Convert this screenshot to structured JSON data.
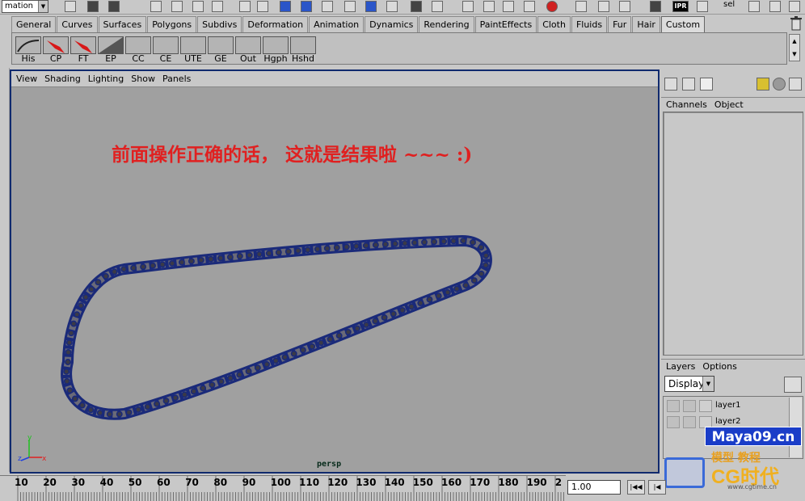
{
  "statusline": {
    "mode": "mation",
    "sel_label": "sel",
    "ipr_label": "IPR"
  },
  "shelf_tabs": [
    "General",
    "Curves",
    "Surfaces",
    "Polygons",
    "Subdivs",
    "Deformation",
    "Animation",
    "Dynamics",
    "Rendering",
    "PaintEffects",
    "Cloth",
    "Fluids",
    "Fur",
    "Hair",
    "Custom"
  ],
  "active_shelf_tab": "Custom",
  "shelf_buttons": [
    "His",
    "CP",
    "FT",
    "EP",
    "CC",
    "CE",
    "UTE",
    "GE",
    "Out",
    "Hgph",
    "Hshd"
  ],
  "panel_menu": [
    "View",
    "Shading",
    "Lighting",
    "Show",
    "Panels"
  ],
  "viewport": {
    "annotation": "前面操作正确的话，  这就是结果啦 ~~~ :)",
    "camera": "persp",
    "chain_color": "#1a2a7a",
    "link_color": "#6a6a78",
    "background": "#a0a0a0"
  },
  "channel_box": {
    "menu": [
      "Channels",
      "Object"
    ]
  },
  "layers": {
    "menu": [
      "Layers",
      "Options"
    ],
    "display_mode": "Display",
    "items": [
      "layer1",
      "layer2"
    ]
  },
  "timeslider": {
    "ticks": [
      "10",
      "20",
      "30",
      "40",
      "50",
      "60",
      "70",
      "80",
      "90",
      "100",
      "110",
      "120",
      "130",
      "140",
      "150",
      "160",
      "170",
      "180",
      "190",
      "2"
    ],
    "current_frame": "1.00"
  },
  "watermark": {
    "site": "Maya09.cn",
    "line2": "模型 教程",
    "brand": "CG时代",
    "url": "www.cgtime.cn"
  }
}
